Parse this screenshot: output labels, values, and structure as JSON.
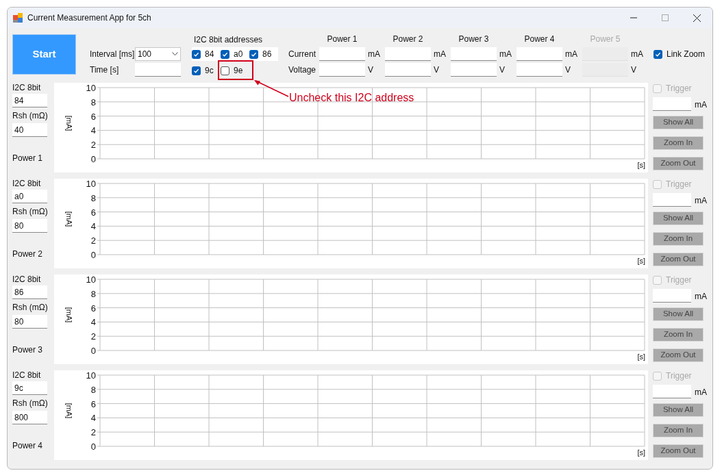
{
  "window": {
    "title": "Current Measurement App for 5ch"
  },
  "start_button": "Start",
  "interval": {
    "label": "Interval [ms]",
    "value": "100"
  },
  "time": {
    "label": "Time [s]"
  },
  "i2c_addresses": {
    "title": "I2C 8bit addresses",
    "items": [
      {
        "label": "84",
        "checked": true
      },
      {
        "label": "a0",
        "checked": true
      },
      {
        "label": "86",
        "checked": true
      },
      {
        "label": "9c",
        "checked": true
      },
      {
        "label": "9e",
        "checked": false
      }
    ]
  },
  "readings": {
    "current_label": "Current",
    "voltage_label": "Voltage",
    "channels": [
      {
        "name": "Power 1",
        "current_unit": "mA",
        "voltage_unit": "V",
        "disabled": false
      },
      {
        "name": "Power 2",
        "current_unit": "mA",
        "voltage_unit": "V",
        "disabled": false
      },
      {
        "name": "Power 3",
        "current_unit": "mA",
        "voltage_unit": "V",
        "disabled": false
      },
      {
        "name": "Power 4",
        "current_unit": "mA",
        "voltage_unit": "V",
        "disabled": false
      },
      {
        "name": "Power 5",
        "current_unit": "mA",
        "voltage_unit": "V",
        "disabled": true
      }
    ]
  },
  "link_zoom": {
    "label": "Link Zoom",
    "checked": true
  },
  "panels": [
    {
      "address_label": "I2C 8bit",
      "address": "84",
      "rsh_label": "Rsh (mΩ)",
      "rsh": "40",
      "name": "Power 1",
      "chart_data": {
        "type": "line",
        "grid": true,
        "categories": [
          null,
          null,
          null,
          null,
          null,
          null,
          null,
          null,
          null,
          null
        ],
        "xlabel": "[s]",
        "ylabel": "[mA]",
        "ylim": [
          0,
          10
        ],
        "yticks": [
          0,
          2,
          4,
          6,
          8,
          10
        ]
      },
      "trigger": {
        "label": "Trigger",
        "checked": false,
        "disabled": true
      },
      "trigger_unit": "mA",
      "buttons": [
        {
          "label": "Show All",
          "disabled": true
        },
        {
          "label": "Zoom In",
          "disabled": true
        },
        {
          "label": "Zoom Out",
          "disabled": true
        }
      ]
    },
    {
      "address_label": "I2C 8bit",
      "address": "a0",
      "rsh_label": "Rsh (mΩ)",
      "rsh": "80",
      "name": "Power 2",
      "chart_data": {
        "type": "line",
        "grid": true,
        "categories": [
          null,
          null,
          null,
          null,
          null,
          null,
          null,
          null,
          null,
          null
        ],
        "xlabel": "[s]",
        "ylabel": "[mA]",
        "ylim": [
          0,
          10
        ],
        "yticks": [
          0,
          2,
          4,
          6,
          8,
          10
        ]
      },
      "trigger": {
        "label": "Trigger",
        "checked": false,
        "disabled": true
      },
      "trigger_unit": "mA",
      "buttons": [
        {
          "label": "Show All",
          "disabled": true
        },
        {
          "label": "Zoom In",
          "disabled": true
        },
        {
          "label": "Zoom Out",
          "disabled": true
        }
      ]
    },
    {
      "address_label": "I2C 8bit",
      "address": "86",
      "rsh_label": "Rsh (mΩ)",
      "rsh": "80",
      "name": "Power 3",
      "chart_data": {
        "type": "line",
        "grid": true,
        "categories": [
          null,
          null,
          null,
          null,
          null,
          null,
          null,
          null,
          null,
          null
        ],
        "xlabel": "[s]",
        "ylabel": "[mA]",
        "ylim": [
          0,
          10
        ],
        "yticks": [
          0,
          2,
          4,
          6,
          8,
          10
        ]
      },
      "trigger": {
        "label": "Trigger",
        "checked": false,
        "disabled": true
      },
      "trigger_unit": "mA",
      "buttons": [
        {
          "label": "Show All",
          "disabled": true
        },
        {
          "label": "Zoom In",
          "disabled": true
        },
        {
          "label": "Zoom Out",
          "disabled": true
        }
      ]
    },
    {
      "address_label": "I2C 8bit",
      "address": "9c",
      "rsh_label": "Rsh (mΩ)",
      "rsh": "800",
      "name": "Power 4",
      "chart_data": {
        "type": "line",
        "grid": true,
        "categories": [
          null,
          null,
          null,
          null,
          null,
          null,
          null,
          null,
          null,
          null
        ],
        "xlabel": "[s]",
        "ylabel": "[mA]",
        "ylim": [
          0,
          10
        ],
        "yticks": [
          0,
          2,
          4,
          6,
          8,
          10
        ]
      },
      "trigger": {
        "label": "Trigger",
        "checked": false,
        "disabled": true
      },
      "trigger_unit": "mA",
      "buttons": [
        {
          "label": "Show All",
          "disabled": true
        },
        {
          "label": "Zoom In",
          "disabled": true
        },
        {
          "label": "Zoom Out",
          "disabled": true
        }
      ]
    }
  ],
  "annotation": {
    "text": "Uncheck this I2C address"
  }
}
